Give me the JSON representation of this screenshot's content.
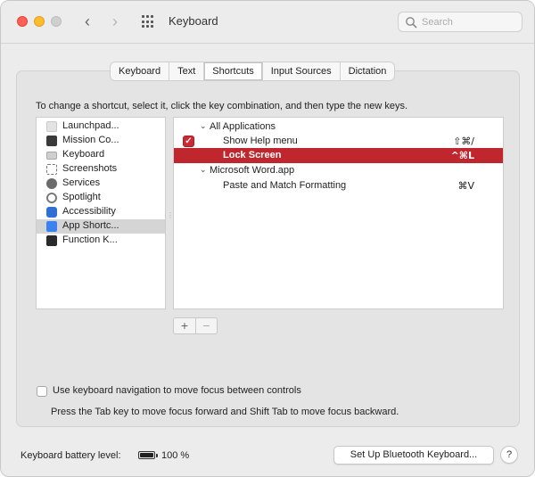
{
  "window": {
    "title": "Keyboard",
    "search_placeholder": "Search"
  },
  "tabs": [
    {
      "label": "Keyboard",
      "active": false
    },
    {
      "label": "Text",
      "active": false
    },
    {
      "label": "Shortcuts",
      "active": true
    },
    {
      "label": "Input Sources",
      "active": false
    },
    {
      "label": "Dictation",
      "active": false
    }
  ],
  "instructions": "To change a shortcut, select it, click the key combination, and then type the new keys.",
  "categories": [
    {
      "label": "Launchpad...",
      "icon": "launchpad-icon",
      "color": "#d8d8d8"
    },
    {
      "label": "Mission Co...",
      "icon": "mission-control-icon",
      "color": "#3a3a3a"
    },
    {
      "label": "Keyboard",
      "icon": "keyboard-icon",
      "color": "#bdbdbd"
    },
    {
      "label": "Screenshots",
      "icon": "screenshots-icon",
      "color": "#9a9a9a"
    },
    {
      "label": "Services",
      "icon": "services-gear-icon",
      "color": "#6b6b6b"
    },
    {
      "label": "Spotlight",
      "icon": "spotlight-icon",
      "color": "#7a7a7a"
    },
    {
      "label": "Accessibility",
      "icon": "accessibility-icon",
      "color": "#2f6fd6"
    },
    {
      "label": "App Shortc...",
      "icon": "app-shortcuts-icon",
      "color": "#3b82f0",
      "selected": true
    },
    {
      "label": "Function K...",
      "icon": "function-keys-icon",
      "color": "#2a2a2a"
    }
  ],
  "shortcuts": {
    "group1": {
      "label": "All Applications",
      "disclosure": "⌄"
    },
    "group1_items": [
      {
        "label": "Show Help menu",
        "keys": "⇧⌘/",
        "checked": true
      },
      {
        "label": "Lock Screen",
        "keys": "^⌘L",
        "selected": true
      }
    ],
    "group2": {
      "label": "Microsoft Word.app",
      "disclosure": "⌄"
    },
    "group2_items": [
      {
        "label": "Paste and Match Formatting",
        "keys": "⌘V"
      }
    ],
    "checkmark": "✓"
  },
  "plus_minus": {
    "plus": "+",
    "minus": "−"
  },
  "keyboard_nav": {
    "label": "Use keyboard navigation to move focus between controls",
    "help": "Press the Tab key to move focus forward and Shift Tab to move focus backward.",
    "checked": false
  },
  "footer": {
    "battery_label": "Keyboard battery level:",
    "battery_percent": "100 %",
    "battery_level": 1.0,
    "bt_button": "Set Up Bluetooth Keyboard...",
    "help_button": "?"
  },
  "colors": {
    "selection": "#c0262e",
    "accent": "#3b82f0"
  }
}
